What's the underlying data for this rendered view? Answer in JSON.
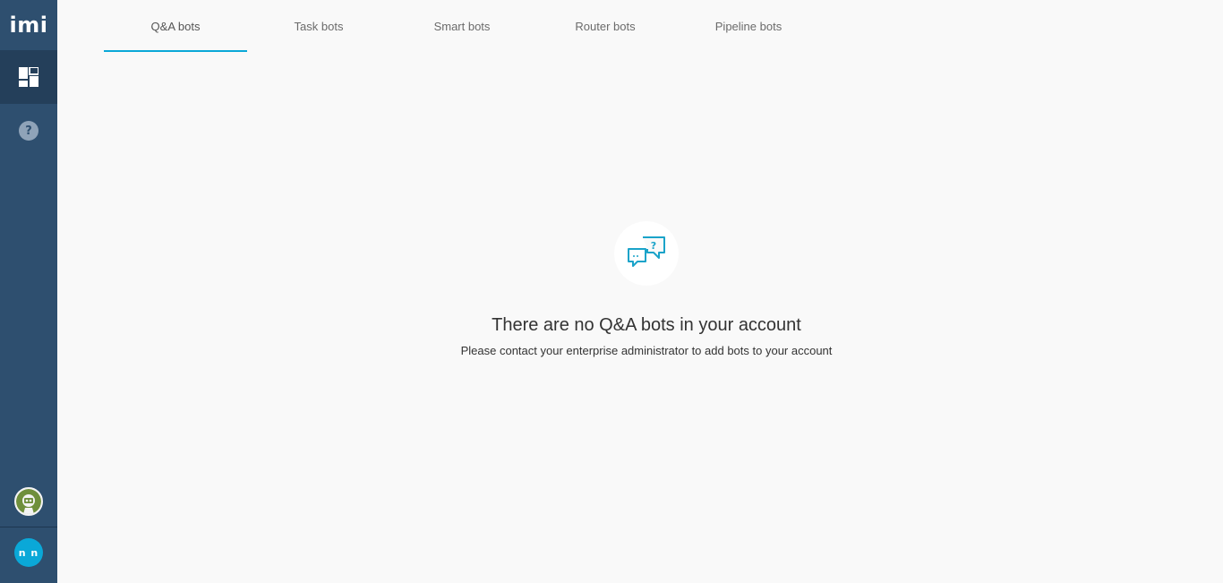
{
  "sidebar": {
    "logo_text": "imi",
    "user_initials": "n n",
    "icons": [
      "dashboard-icon",
      "help-icon",
      "workspace-avatar",
      "user-avatar"
    ]
  },
  "tabs": [
    {
      "label": "Q&A bots",
      "active": true
    },
    {
      "label": "Task bots",
      "active": false
    },
    {
      "label": "Smart bots",
      "active": false
    },
    {
      "label": "Router bots",
      "active": false
    },
    {
      "label": "Pipeline bots",
      "active": false
    }
  ],
  "empty_state": {
    "icon": "chat-question-icon",
    "title": "There are no Q&A bots in your account",
    "subtitle": "Please contact your enterprise administrator to add bots to your account"
  },
  "colors": {
    "sidebar_bg": "#2e4f6f",
    "sidebar_active": "#243f5a",
    "accent": "#0aa8d8",
    "page_bg": "#f9f9f9"
  }
}
